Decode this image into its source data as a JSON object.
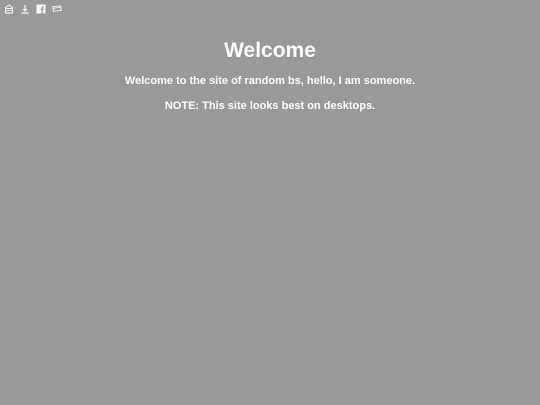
{
  "toolbar": {
    "icons": [
      "home-icon",
      "download-icon",
      "facebook-icon",
      "stack-icon"
    ]
  },
  "main": {
    "title": "Welcome",
    "intro": "Welcome to the site of random bs, hello, I am someone.",
    "note": "NOTE: This site looks best on desktops."
  },
  "colors": {
    "background": "#999999",
    "text": "#ffffff"
  }
}
